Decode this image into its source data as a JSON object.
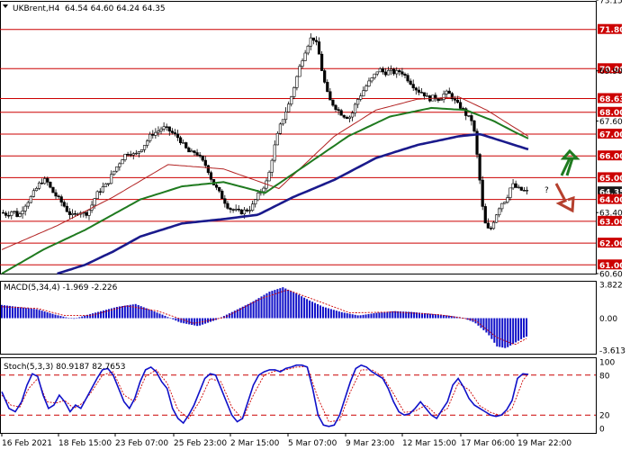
{
  "header": {
    "symbol": "UKBrent,H4",
    "ohlc": "64.54 64.60 64.24 64.35"
  },
  "chart_data": [
    {
      "type": "candlestick",
      "title": "UKBrent,H4 64.54 64.60 64.24 64.35",
      "x_tick_labels": [
        "16 Feb 2021",
        "18 Feb 15:00",
        "23 Feb 07:00",
        "25 Feb 23:00",
        "2 Mar 15:00",
        "5 Mar 07:00",
        "9 Mar 23:00",
        "12 Mar 15:00",
        "17 Mar 06:00",
        "19 Mar 22:00"
      ],
      "y_tick_labels": [
        "73.15",
        "71.80",
        "70.00",
        "69.90",
        "68.63",
        "68.00",
        "67.60",
        "67.00",
        "66.00",
        "65.00",
        "64.35",
        "64.00",
        "63.40",
        "63.00",
        "62.00",
        "61.00",
        "60.60"
      ],
      "ylim": [
        60.6,
        73.15
      ],
      "levels": [
        71.8,
        70.0,
        68.63,
        68.0,
        67.0,
        66.0,
        65.0,
        64.0,
        63.0,
        62.0,
        61.0
      ],
      "current_price": "64.35",
      "close_path": [
        [
          0,
          63.4
        ],
        [
          4,
          63.3
        ],
        [
          8,
          63.5
        ],
        [
          12,
          63.2
        ],
        [
          16,
          63.7
        ],
        [
          20,
          64.0
        ],
        [
          24,
          64.4
        ],
        [
          28,
          64.8
        ],
        [
          32,
          64.9
        ],
        [
          36,
          64.4
        ],
        [
          40,
          64.1
        ],
        [
          44,
          63.8
        ],
        [
          48,
          63.4
        ],
        [
          52,
          63.2
        ],
        [
          56,
          63.5
        ],
        [
          60,
          63.3
        ],
        [
          64,
          63.6
        ],
        [
          68,
          64.2
        ],
        [
          72,
          64.5
        ],
        [
          76,
          64.7
        ],
        [
          80,
          65.2
        ],
        [
          84,
          65.6
        ],
        [
          88,
          66.0
        ],
        [
          92,
          66.2
        ],
        [
          96,
          66.0
        ],
        [
          100,
          66.3
        ],
        [
          104,
          66.6
        ],
        [
          108,
          67.0
        ],
        [
          112,
          67.1
        ],
        [
          116,
          67.3
        ],
        [
          120,
          67.2
        ],
        [
          124,
          67.0
        ],
        [
          128,
          66.8
        ],
        [
          132,
          66.4
        ],
        [
          136,
          66.1
        ],
        [
          140,
          66.2
        ],
        [
          144,
          65.8
        ],
        [
          148,
          65.5
        ],
        [
          152,
          64.8
        ],
        [
          156,
          64.4
        ],
        [
          160,
          64.0
        ],
        [
          164,
          63.6
        ],
        [
          168,
          63.5
        ],
        [
          172,
          63.4
        ],
        [
          176,
          63.5
        ],
        [
          180,
          63.6
        ],
        [
          184,
          64.1
        ],
        [
          188,
          64.5
        ],
        [
          192,
          64.9
        ],
        [
          196,
          66.2
        ],
        [
          200,
          67.2
        ],
        [
          204,
          67.9
        ],
        [
          208,
          68.5
        ],
        [
          212,
          69.4
        ],
        [
          216,
          70.3
        ],
        [
          220,
          71.0
        ],
        [
          224,
          71.5
        ],
        [
          228,
          71.0
        ],
        [
          232,
          69.6
        ],
        [
          236,
          68.6
        ],
        [
          240,
          68.3
        ],
        [
          244,
          68.0
        ],
        [
          248,
          67.8
        ],
        [
          252,
          67.8
        ],
        [
          256,
          68.5
        ],
        [
          260,
          68.9
        ],
        [
          264,
          69.3
        ],
        [
          268,
          69.6
        ],
        [
          272,
          70.0
        ],
        [
          276,
          69.8
        ],
        [
          280,
          69.9
        ],
        [
          284,
          69.8
        ],
        [
          288,
          69.9
        ],
        [
          292,
          69.6
        ],
        [
          296,
          69.3
        ],
        [
          300,
          69.0
        ],
        [
          304,
          68.9
        ],
        [
          308,
          68.6
        ],
        [
          312,
          68.7
        ],
        [
          316,
          68.6
        ],
        [
          320,
          68.9
        ],
        [
          324,
          68.8
        ],
        [
          328,
          68.4
        ],
        [
          332,
          68.2
        ],
        [
          336,
          67.8
        ],
        [
          340,
          67.6
        ],
        [
          344,
          65.5
        ],
        [
          348,
          63.0
        ],
        [
          352,
          62.5
        ],
        [
          356,
          63.2
        ],
        [
          360,
          63.8
        ],
        [
          364,
          64.0
        ],
        [
          368,
          64.7
        ],
        [
          372,
          64.5
        ],
        [
          376,
          64.4
        ],
        [
          380,
          64.35
        ]
      ],
      "ma_fast": [
        [
          0,
          61.7
        ],
        [
          40,
          62.8
        ],
        [
          80,
          64.1
        ],
        [
          120,
          65.6
        ],
        [
          160,
          65.4
        ],
        [
          200,
          64.5
        ],
        [
          240,
          66.9
        ],
        [
          270,
          68.1
        ],
        [
          300,
          68.6
        ],
        [
          330,
          68.7
        ],
        [
          350,
          68.1
        ],
        [
          370,
          67.3
        ],
        [
          380,
          66.9
        ]
      ],
      "ma_mid": [
        [
          0,
          60.6
        ],
        [
          30,
          61.7
        ],
        [
          60,
          62.6
        ],
        [
          100,
          64.0
        ],
        [
          130,
          64.6
        ],
        [
          160,
          64.8
        ],
        [
          190,
          64.3
        ],
        [
          220,
          65.6
        ],
        [
          250,
          66.9
        ],
        [
          280,
          67.8
        ],
        [
          310,
          68.2
        ],
        [
          335,
          68.1
        ],
        [
          355,
          67.6
        ],
        [
          370,
          67.1
        ],
        [
          380,
          66.8
        ]
      ],
      "ma_slow": [
        [
          40,
          60.6
        ],
        [
          60,
          61.0
        ],
        [
          80,
          61.6
        ],
        [
          100,
          62.3
        ],
        [
          130,
          62.9
        ],
        [
          160,
          63.1
        ],
        [
          185,
          63.3
        ],
        [
          210,
          64.1
        ],
        [
          240,
          64.9
        ],
        [
          270,
          65.9
        ],
        [
          300,
          66.5
        ],
        [
          330,
          66.9
        ],
        [
          345,
          67.0
        ],
        [
          360,
          66.7
        ],
        [
          380,
          66.3
        ]
      ],
      "arrows": {
        "up_color": "#2e7d32",
        "down_color": "#b5402e",
        "question_mark": "?"
      }
    },
    {
      "type": "bar",
      "label": "MACD(5,34,4) -1.969 -2.226",
      "y_tick_labels": [
        "3.822",
        "0.00",
        "-3.613"
      ],
      "ylim": [
        -3.613,
        3.822
      ],
      "bar_series": [
        [
          0,
          1.5
        ],
        [
          40,
          1.0
        ],
        [
          60,
          0.4
        ],
        [
          80,
          -0.1
        ],
        [
          100,
          0.5
        ],
        [
          130,
          1.3
        ],
        [
          150,
          1.6
        ],
        [
          165,
          1.0
        ],
        [
          180,
          0.4
        ],
        [
          200,
          -0.5
        ],
        [
          220,
          -0.9
        ],
        [
          240,
          -0.2
        ],
        [
          260,
          0.8
        ],
        [
          280,
          1.8
        ],
        [
          300,
          3.0
        ],
        [
          315,
          3.5
        ],
        [
          330,
          2.8
        ],
        [
          345,
          2.0
        ],
        [
          360,
          1.3
        ],
        [
          380,
          0.7
        ],
        [
          400,
          0.3
        ],
        [
          420,
          0.6
        ],
        [
          440,
          0.8
        ],
        [
          460,
          0.7
        ],
        [
          480,
          0.5
        ],
        [
          500,
          0.3
        ],
        [
          515,
          0.1
        ],
        [
          530,
          -0.5
        ],
        [
          545,
          -1.8
        ],
        [
          555,
          -3.2
        ],
        [
          565,
          -3.4
        ],
        [
          575,
          -2.8
        ],
        [
          585,
          -2.2
        ],
        [
          590,
          -2.0
        ]
      ],
      "signal_series": [
        [
          0,
          1.3
        ],
        [
          40,
          1.1
        ],
        [
          70,
          0.3
        ],
        [
          100,
          0.3
        ],
        [
          140,
          1.4
        ],
        [
          175,
          0.8
        ],
        [
          215,
          -0.6
        ],
        [
          250,
          0.1
        ],
        [
          290,
          2.2
        ],
        [
          320,
          3.2
        ],
        [
          350,
          2.1
        ],
        [
          390,
          0.6
        ],
        [
          440,
          0.7
        ],
        [
          490,
          0.4
        ],
        [
          530,
          -0.2
        ],
        [
          555,
          -2.2
        ],
        [
          575,
          -3.0
        ],
        [
          590,
          -2.2
        ]
      ]
    },
    {
      "type": "line",
      "label": "Stoch(5,3,3) 80.9187 82.7653",
      "y_tick_labels": [
        "100",
        "80",
        "20",
        "0"
      ],
      "ylim": [
        0,
        100
      ],
      "levels": [
        80,
        20
      ],
      "k_series": [
        [
          0,
          55
        ],
        [
          8,
          30
        ],
        [
          15,
          25
        ],
        [
          22,
          40
        ],
        [
          28,
          65
        ],
        [
          34,
          82
        ],
        [
          40,
          78
        ],
        [
          46,
          50
        ],
        [
          52,
          30
        ],
        [
          58,
          35
        ],
        [
          64,
          50
        ],
        [
          70,
          40
        ],
        [
          76,
          25
        ],
        [
          82,
          35
        ],
        [
          88,
          30
        ],
        [
          94,
          45
        ],
        [
          100,
          60
        ],
        [
          106,
          75
        ],
        [
          112,
          88
        ],
        [
          118,
          90
        ],
        [
          124,
          80
        ],
        [
          130,
          60
        ],
        [
          136,
          40
        ],
        [
          142,
          30
        ],
        [
          148,
          45
        ],
        [
          154,
          70
        ],
        [
          160,
          88
        ],
        [
          166,
          92
        ],
        [
          172,
          85
        ],
        [
          178,
          70
        ],
        [
          184,
          60
        ],
        [
          190,
          30
        ],
        [
          196,
          15
        ],
        [
          202,
          8
        ],
        [
          208,
          20
        ],
        [
          214,
          35
        ],
        [
          220,
          55
        ],
        [
          226,
          75
        ],
        [
          232,
          82
        ],
        [
          238,
          80
        ],
        [
          244,
          60
        ],
        [
          250,
          40
        ],
        [
          256,
          20
        ],
        [
          262,
          10
        ],
        [
          268,
          15
        ],
        [
          274,
          40
        ],
        [
          280,
          65
        ],
        [
          286,
          80
        ],
        [
          292,
          85
        ],
        [
          298,
          88
        ],
        [
          304,
          88
        ],
        [
          310,
          85
        ],
        [
          316,
          90
        ],
        [
          322,
          92
        ],
        [
          328,
          95
        ],
        [
          334,
          95
        ],
        [
          340,
          92
        ],
        [
          346,
          60
        ],
        [
          352,
          20
        ],
        [
          358,
          5
        ],
        [
          364,
          3
        ],
        [
          370,
          5
        ],
        [
          376,
          20
        ],
        [
          382,
          45
        ],
        [
          388,
          70
        ],
        [
          394,
          90
        ],
        [
          400,
          95
        ],
        [
          406,
          92
        ],
        [
          412,
          85
        ],
        [
          418,
          80
        ],
        [
          424,
          75
        ],
        [
          430,
          60
        ],
        [
          436,
          40
        ],
        [
          442,
          25
        ],
        [
          448,
          20
        ],
        [
          454,
          22
        ],
        [
          460,
          30
        ],
        [
          466,
          40
        ],
        [
          472,
          30
        ],
        [
          478,
          20
        ],
        [
          484,
          15
        ],
        [
          490,
          28
        ],
        [
          496,
          40
        ],
        [
          502,
          65
        ],
        [
          508,
          75
        ],
        [
          514,
          62
        ],
        [
          520,
          45
        ],
        [
          526,
          35
        ],
        [
          532,
          30
        ],
        [
          538,
          25
        ],
        [
          544,
          20
        ],
        [
          550,
          18
        ],
        [
          556,
          20
        ],
        [
          562,
          28
        ],
        [
          568,
          42
        ],
        [
          574,
          75
        ],
        [
          580,
          82
        ],
        [
          586,
          81
        ]
      ],
      "d_series": [
        [
          0,
          50
        ],
        [
          10,
          35
        ],
        [
          20,
          32
        ],
        [
          30,
          60
        ],
        [
          40,
          75
        ],
        [
          50,
          40
        ],
        [
          60,
          38
        ],
        [
          70,
          42
        ],
        [
          80,
          30
        ],
        [
          90,
          38
        ],
        [
          100,
          55
        ],
        [
          112,
          80
        ],
        [
          124,
          85
        ],
        [
          136,
          50
        ],
        [
          148,
          40
        ],
        [
          160,
          78
        ],
        [
          172,
          88
        ],
        [
          184,
          68
        ],
        [
          196,
          28
        ],
        [
          208,
          15
        ],
        [
          220,
          40
        ],
        [
          232,
          75
        ],
        [
          244,
          70
        ],
        [
          256,
          32
        ],
        [
          268,
          14
        ],
        [
          280,
          50
        ],
        [
          292,
          80
        ],
        [
          304,
          86
        ],
        [
          316,
          88
        ],
        [
          328,
          92
        ],
        [
          340,
          93
        ],
        [
          352,
          45
        ],
        [
          364,
          10
        ],
        [
          376,
          12
        ],
        [
          388,
          55
        ],
        [
          400,
          88
        ],
        [
          412,
          88
        ],
        [
          424,
          78
        ],
        [
          436,
          52
        ],
        [
          448,
          24
        ],
        [
          460,
          26
        ],
        [
          472,
          35
        ],
        [
          484,
          20
        ],
        [
          496,
          30
        ],
        [
          508,
          68
        ],
        [
          520,
          58
        ],
        [
          532,
          34
        ],
        [
          544,
          24
        ],
        [
          556,
          19
        ],
        [
          568,
          30
        ],
        [
          580,
          72
        ],
        [
          586,
          82
        ]
      ]
    }
  ],
  "colors": {
    "level_line": "#cc0000",
    "level_label_bg": "#cc0000",
    "price_label_bg": "#1a1a1a",
    "candle_up": "#ffffff",
    "candle_down": "#000000",
    "ma_fast": "#b22222",
    "ma_mid": "#1f7a1f",
    "ma_slow": "#1a1a8c",
    "macd_bars": "#1010c8",
    "macd_signal": "#cc0000",
    "stoch_k": "#1010c8",
    "stoch_d": "#cc0000",
    "panel_border": "#000000"
  }
}
